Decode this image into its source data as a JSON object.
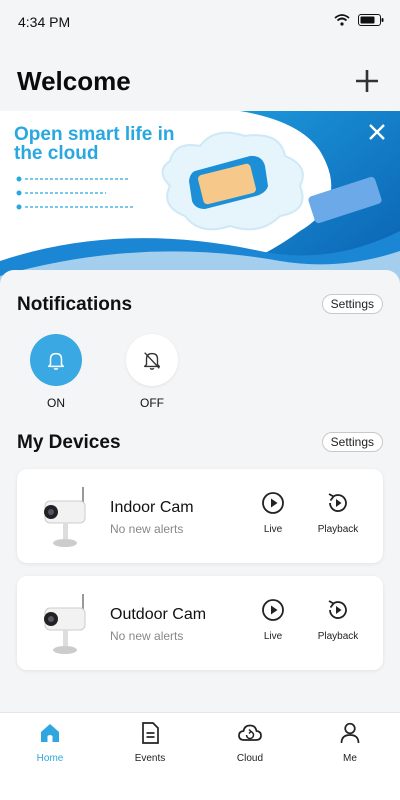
{
  "status_bar": {
    "time": "4:34 PM"
  },
  "header": {
    "title": "Welcome",
    "add_icon": "plus-icon"
  },
  "banner": {
    "title": "Open smart life in the cloud",
    "close_icon": "close-icon",
    "accent_color": "#29a8e0"
  },
  "notifications": {
    "title": "Notifications",
    "settings_label": "Settings",
    "on_label": "ON",
    "off_label": "OFF",
    "selected": "ON",
    "on_color": "#3aa9e3"
  },
  "devices": {
    "title": "My Devices",
    "settings_label": "Settings",
    "items": [
      {
        "name": "Indoor Cam",
        "status": "No new alerts",
        "live_label": "Live",
        "playback_label": "Playback"
      },
      {
        "name": "Outdoor Cam",
        "status": "No new alerts",
        "live_label": "Live",
        "playback_label": "Playback"
      }
    ]
  },
  "tabbar": {
    "items": [
      {
        "label": "Home",
        "icon": "home-icon",
        "active": true
      },
      {
        "label": "Events",
        "icon": "document-icon",
        "active": false
      },
      {
        "label": "Cloud",
        "icon": "cloud-icon",
        "active": false
      },
      {
        "label": "Me",
        "icon": "user-icon",
        "active": false
      }
    ],
    "active_color": "#2fa6e0"
  }
}
